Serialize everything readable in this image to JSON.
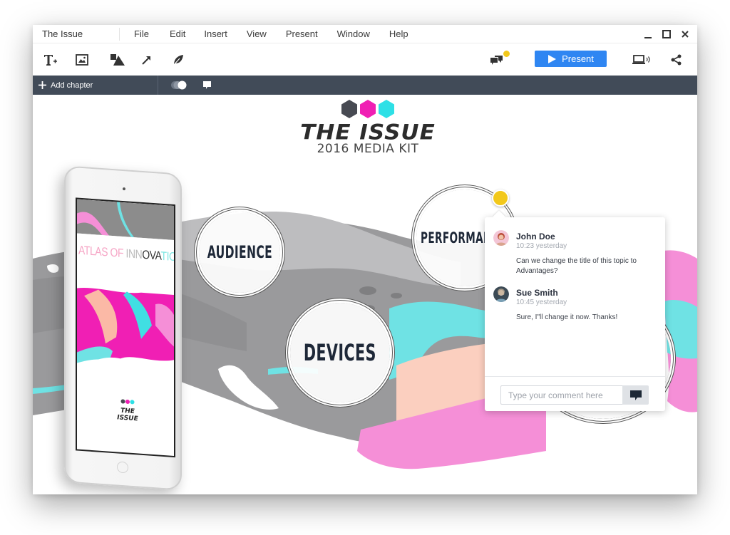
{
  "window": {
    "doc_title": "The Issue",
    "controls": {
      "minimize": "minimize-icon",
      "maximize": "maximize-icon",
      "close": "close-icon"
    }
  },
  "menu": [
    "File",
    "Edit",
    "Insert",
    "View",
    "Present",
    "Window",
    "Help"
  ],
  "toolbar": {
    "tools": [
      "text-add-icon",
      "image-icon",
      "shapes-icon",
      "arrow-icon",
      "leaf-icon"
    ],
    "comments_icon": "comments-icon",
    "present_label": "Present",
    "present_color": "#2f86f2",
    "remote_icon": "laptop-broadcast-icon",
    "share_icon": "share-icon",
    "notification_color": "#f2c81b"
  },
  "chapterbar": {
    "add_chapter_label": "Add chapter",
    "bg_color": "#414b58"
  },
  "canvas": {
    "logo": {
      "title": "THE ISSUE",
      "subtitle": "2016 MEDIA KIT",
      "hex_colors": [
        "#474a52",
        "#f01fb4",
        "#2ee0e6"
      ]
    },
    "topics": [
      {
        "label": "AUDIENCE"
      },
      {
        "label": "DEVICES"
      },
      {
        "label": "PERFORMANCE"
      }
    ],
    "ipad": {
      "headline_parts": [
        "ATLAS OF ",
        "INN",
        "OVA",
        "TION"
      ],
      "mini_title": "THE ISSUE"
    }
  },
  "comments": {
    "thread": [
      {
        "author": "John Doe",
        "time": "10:23 yesterday",
        "text": "Can we change the title of this topic to Advantages?"
      },
      {
        "author": "Sue Smith",
        "time": "10:45 yesterday",
        "text": "Sure, I\"ll change it now. Thanks!"
      }
    ],
    "input_placeholder": "Type your comment here",
    "input_value": "",
    "pin_color": "#f2c81b"
  }
}
